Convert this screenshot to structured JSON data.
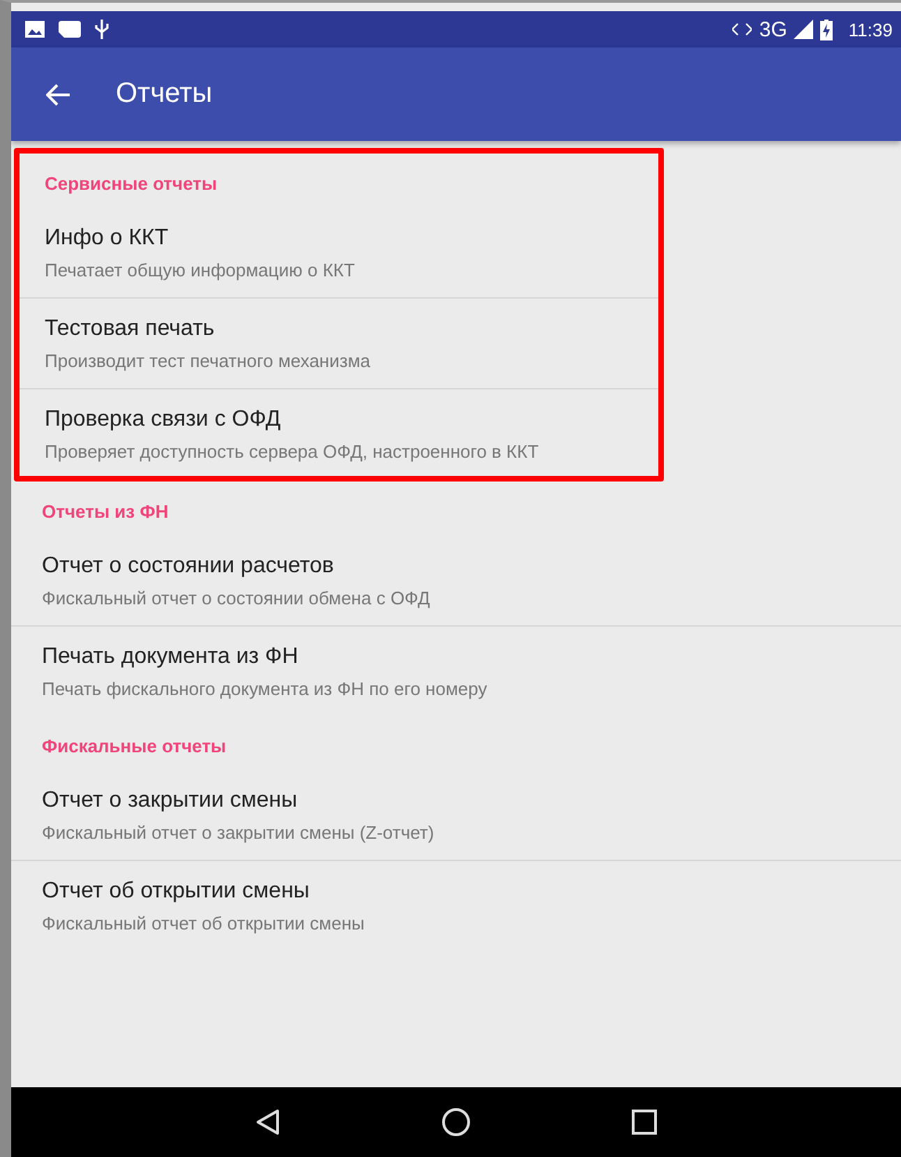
{
  "status_bar": {
    "network": "3G",
    "time": "11:39"
  },
  "app_bar": {
    "title": "Отчеты"
  },
  "sections": [
    {
      "title": "Сервисные отчеты",
      "highlighted": true,
      "items": [
        {
          "title": "Инфо о ККТ",
          "subtitle": "Печатает общую информацию о ККТ"
        },
        {
          "title": "Тестовая печать",
          "subtitle": "Производит тест печатного механизма"
        },
        {
          "title": "Проверка связи с ОФД",
          "subtitle": "Проверяет доступность сервера ОФД, настроенного в ККТ"
        }
      ]
    },
    {
      "title": "Отчеты из ФН",
      "highlighted": false,
      "items": [
        {
          "title": "Отчет о состоянии расчетов",
          "subtitle": "Фискальный отчет о состоянии обмена с ОФД"
        },
        {
          "title": "Печать документа из ФН",
          "subtitle": "Печать фискального документа из ФН по его номеру"
        }
      ]
    },
    {
      "title": "Фискальные отчеты",
      "highlighted": false,
      "items": [
        {
          "title": "Отчет о закрытии смены",
          "subtitle": "Фискальный отчет о закрытии смены (Z-отчет)"
        },
        {
          "title": "Отчет об открытии смены",
          "subtitle": "Фискальный отчет об открытии смены"
        }
      ]
    }
  ]
}
